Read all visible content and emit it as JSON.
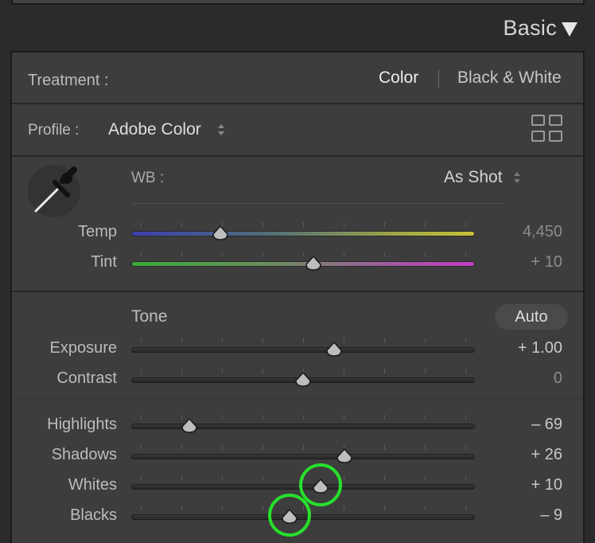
{
  "header": {
    "title": "Basic"
  },
  "treatment": {
    "label": "Treatment :",
    "options": [
      "Color",
      "Black & White"
    ],
    "selected": "Color"
  },
  "profile": {
    "label": "Profile :",
    "value": "Adobe Color"
  },
  "wb": {
    "label": "WB :",
    "value": "As Shot"
  },
  "tone": {
    "label": "Tone",
    "auto_label": "Auto"
  },
  "sliders": [
    {
      "id": "temp",
      "label": "Temp",
      "value": "4,450",
      "position": 0.26
    },
    {
      "id": "tint",
      "label": "Tint",
      "value": "+ 10",
      "position": 0.53
    },
    {
      "id": "exposure",
      "label": "Exposure",
      "value": "+ 1.00",
      "position": 0.59
    },
    {
      "id": "contrast",
      "label": "Contrast",
      "value": "0",
      "position": 0.5
    },
    {
      "id": "highlights",
      "label": "Highlights",
      "value": "– 69",
      "position": 0.17
    },
    {
      "id": "shadows",
      "label": "Shadows",
      "value": "+ 26",
      "position": 0.62
    },
    {
      "id": "whites",
      "label": "Whites",
      "value": "+ 10",
      "position": 0.55
    },
    {
      "id": "blacks",
      "label": "Blacks",
      "value": "– 9",
      "position": 0.46
    }
  ],
  "colors": {
    "highlight_ring": "#27e02c",
    "panel_bg": "#3d3d3d"
  }
}
